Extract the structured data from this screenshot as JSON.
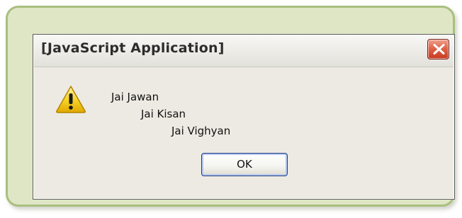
{
  "dialog": {
    "title": "[JavaScript Application]",
    "close_icon": "close-icon",
    "warning_icon": "warning-icon",
    "message_lines": [
      "Jai Jawan",
      "Jai Kisan",
      "Jai Vighyan"
    ],
    "ok_label": "OK"
  },
  "colors": {
    "frame_background": "#dfe6c6",
    "frame_border": "#a9bf7e",
    "dialog_background": "#eceae2",
    "close_button": "#d9503a",
    "warning_yellow": "#f5d20f"
  }
}
